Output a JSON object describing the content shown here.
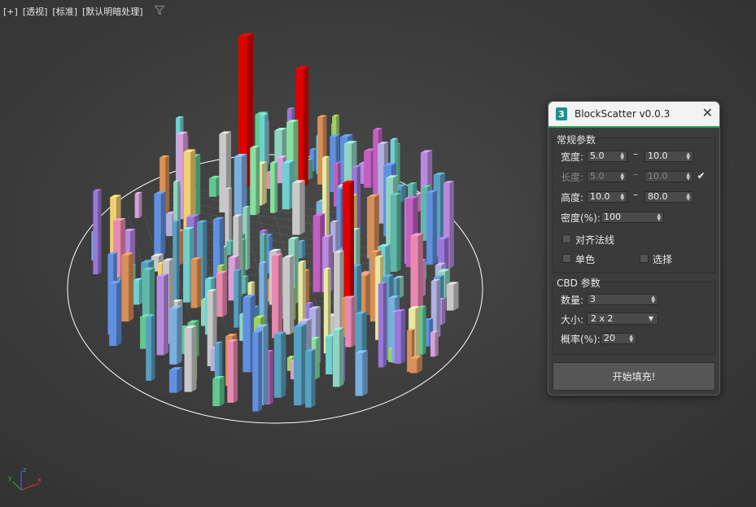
{
  "viewport": {
    "labels": [
      "[+]",
      "[透视]",
      "[标准]",
      "[默认明暗处理]"
    ],
    "filter_icon": "filter-icon",
    "background": "#404040"
  },
  "scene": {
    "accent_column_color": "#e00000",
    "selection_circle_color": "#ffffff",
    "grid_color": "#7a7a7a"
  },
  "panel": {
    "title": "BlockScatter v0.0.3",
    "app_icon_glyph": "3",
    "close_glyph": "✕",
    "accent_color": "#2e9e56",
    "general": {
      "label": "常规参数",
      "width": {
        "label": "宽度:",
        "min": "5.0",
        "max": "10.0"
      },
      "length": {
        "label": "长度:",
        "min": "5.0",
        "max": "10.0",
        "checked": true
      },
      "height": {
        "label": "高度:",
        "min": "10.0",
        "max": "80.0"
      },
      "density": {
        "label": "密度(%):",
        "value": "100"
      },
      "align_normal": {
        "label": "对齐法线",
        "checked": false
      },
      "single_color": {
        "label": "单色",
        "checked": false
      },
      "select": {
        "label": "选择",
        "checked": false
      }
    },
    "cbd": {
      "label": "CBD 参数",
      "count": {
        "label": "数量:",
        "value": "3"
      },
      "size": {
        "label": "大小:",
        "value": "2 x 2"
      },
      "probability": {
        "label": "概率(%):",
        "value": "20"
      }
    },
    "fill_button": "开始填充!"
  },
  "gizmo": {
    "axes": [
      "x",
      "y",
      "z"
    ]
  }
}
